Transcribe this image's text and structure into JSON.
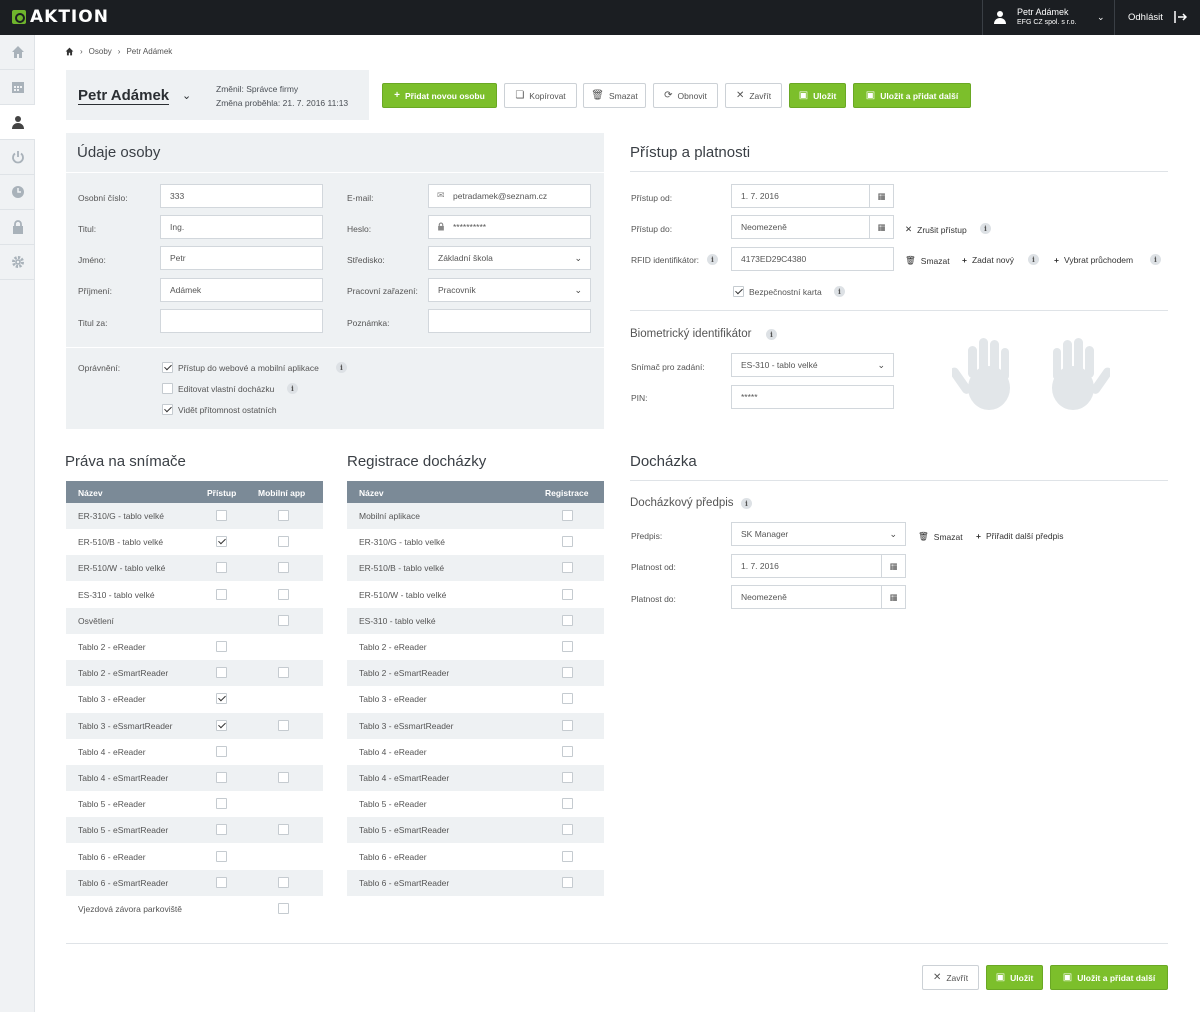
{
  "app": {
    "logo_text": "AKTION",
    "brand_color": "#7cbf2b"
  },
  "user": {
    "name": "Petr Adámek",
    "org": "EFG CZ spol. s r.o.",
    "logout_label": "Odhlásit"
  },
  "sidebar": {
    "items": [
      "home-icon",
      "calendar-icon",
      "person-icon",
      "power-icon",
      "clock-icon",
      "lock-icon",
      "gear-icon"
    ]
  },
  "breadcrumb": {
    "items": [
      "Osoby",
      "Petr Adámek"
    ]
  },
  "header": {
    "person_name": "Petr Adámek",
    "changed_by": "Změnil: Správce firmy",
    "changed_at": "Změna proběhla: 21. 7. 2016 11:13"
  },
  "toolbar": {
    "add": "Přidat novou osobu",
    "copy": "Kopírovat",
    "delete": "Smazat",
    "refresh": "Obnovit",
    "close": "Zavřít",
    "save": "Uložit",
    "save_add": "Uložit a přidat další"
  },
  "person_form": {
    "title": "Údaje osoby",
    "personal_number_label": "Osobní číslo:",
    "personal_number": "333",
    "title_label": "Titul:",
    "title_value": "Ing.",
    "first_name_label": "Jméno:",
    "first_name": "Petr",
    "last_name_label": "Příjmení:",
    "last_name": "Adámek",
    "title_after_label": "Titul za:",
    "title_after": "",
    "email_label": "E-mail:",
    "email": "petradamek@seznam.cz",
    "password_label": "Heslo:",
    "password": "**********",
    "center_label": "Středisko:",
    "center": "Základní škola",
    "position_label": "Pracovní zařazení:",
    "position": "Pracovník",
    "note_label": "Poznámka:",
    "note": "",
    "permissions_label": "Oprávnění:",
    "permissions": [
      {
        "label": "Přístup do webové a mobilní aplikace",
        "checked": true,
        "info": true
      },
      {
        "label": "Editovat vlastní docházku",
        "checked": false,
        "info": true
      },
      {
        "label": "Vidět přítomnost ostatních",
        "checked": true,
        "info": false
      }
    ]
  },
  "access": {
    "title": "Přístup a platnosti",
    "from_label": "Přístup od:",
    "from": "1. 7. 2016",
    "to_label": "Přístup do:",
    "to": "Neomezeně",
    "cancel_access": "Zrušit přístup",
    "rfid_label": "RFID identifikátor:",
    "rfid": "4173ED29C4380",
    "rfid_delete": "Smazat",
    "rfid_new": "Zadat nový",
    "rfid_pass": "Vybrat průchodem",
    "security_card": "Bezpečnostní karta",
    "security_card_checked": true
  },
  "biometric": {
    "title": "Biometrický identifikátor",
    "reader_label": "Snímač pro zadání:",
    "reader": "ES-310 - tablo velké",
    "pin_label": "PIN:",
    "pin": "*****"
  },
  "attendance": {
    "title": "Docházka",
    "subtitle": "Docházkový předpis",
    "rule_label": "Předpis:",
    "rule": "SK Manager",
    "rule_delete": "Smazat",
    "rule_add": "Přiřadit další předpis",
    "valid_from_label": "Platnost od:",
    "valid_from": "1. 7. 2016",
    "valid_to_label": "Platnost do:",
    "valid_to": "Neomezeně"
  },
  "readers": {
    "title": "Práva na snímače",
    "headers": [
      "Název",
      "Přístup",
      "Mobilní app"
    ],
    "rows": [
      {
        "name": "ER-310/G - tablo velké",
        "access": false,
        "mobile": false
      },
      {
        "name": "ER-510/B - tablo velké",
        "access": true,
        "mobile": false
      },
      {
        "name": "ER-510/W - tablo velké",
        "access": false,
        "mobile": false
      },
      {
        "name": "ES-310 - tablo velké",
        "access": false,
        "mobile": false
      },
      {
        "name": "Osvětlení",
        "access": null,
        "mobile": false
      },
      {
        "name": "Tablo 2 - eReader",
        "access": false,
        "mobile": null
      },
      {
        "name": "Tablo 2 - eSmartReader",
        "access": false,
        "mobile": false
      },
      {
        "name": "Tablo 3 - eReader",
        "access": true,
        "mobile": null
      },
      {
        "name": "Tablo 3 - eSsmartReader",
        "access": true,
        "mobile": false
      },
      {
        "name": "Tablo 4 - eReader",
        "access": false,
        "mobile": null
      },
      {
        "name": "Tablo 4 - eSmartReader",
        "access": false,
        "mobile": false
      },
      {
        "name": "Tablo 5 - eReader",
        "access": false,
        "mobile": null
      },
      {
        "name": "Tablo 5 - eSmartReader",
        "access": false,
        "mobile": false
      },
      {
        "name": "Tablo 6 - eReader",
        "access": false,
        "mobile": null
      },
      {
        "name": "Tablo 6 - eSmartReader",
        "access": false,
        "mobile": false
      },
      {
        "name": "Vjezdová závora parkoviště",
        "access": null,
        "mobile": false
      }
    ]
  },
  "registration": {
    "title": "Registrace docházky",
    "headers": [
      "Název",
      "Registrace"
    ],
    "rows": [
      {
        "name": "Mobilní aplikace",
        "reg": false
      },
      {
        "name": "ER-310/G - tablo velké",
        "reg": false
      },
      {
        "name": "ER-510/B - tablo velké",
        "reg": false
      },
      {
        "name": "ER-510/W - tablo velké",
        "reg": false
      },
      {
        "name": "ES-310 - tablo velké",
        "reg": false
      },
      {
        "name": "Tablo 2 - eReader",
        "reg": false
      },
      {
        "name": "Tablo 2 - eSmartReader",
        "reg": false
      },
      {
        "name": "Tablo 3 - eReader",
        "reg": false
      },
      {
        "name": "Tablo 3 - eSsmartReader",
        "reg": false
      },
      {
        "name": "Tablo 4 - eReader",
        "reg": false
      },
      {
        "name": "Tablo 4 - eSmartReader",
        "reg": false
      },
      {
        "name": "Tablo 5 - eReader",
        "reg": false
      },
      {
        "name": "Tablo 5 - eSmartReader",
        "reg": false
      },
      {
        "name": "Tablo 6 - eReader",
        "reg": false
      },
      {
        "name": "Tablo 6 - eSmartReader",
        "reg": false
      }
    ]
  },
  "footer": {
    "close": "Zavřít",
    "save": "Uložit",
    "save_add": "Uložit a přidat další"
  }
}
